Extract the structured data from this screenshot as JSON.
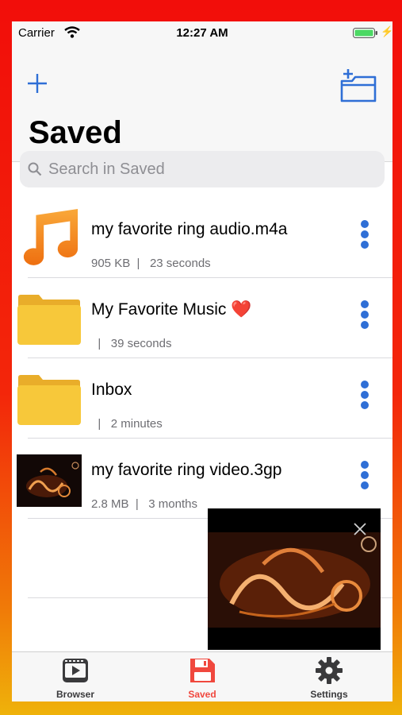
{
  "status_bar": {
    "carrier": "Carrier",
    "time": "12:27 AM"
  },
  "header": {
    "title": "Saved",
    "add_icon": "plus-icon",
    "new_folder_icon": "folder-plus-icon"
  },
  "search": {
    "placeholder": "Search in Saved",
    "value": ""
  },
  "items": [
    {
      "name": "my favorite ring audio.m4a",
      "meta": "905 KB  |   23 seconds",
      "icon": "music-note-icon"
    },
    {
      "name": "My Favorite Music ❤️",
      "meta": "  |   39 seconds",
      "icon": "folder-icon"
    },
    {
      "name": "Inbox",
      "meta": "  |   2 minutes",
      "icon": "folder-icon"
    },
    {
      "name": "my favorite ring video.3gp",
      "meta": "2.8 MB  |   3 months",
      "icon": "video-thumbnail"
    }
  ],
  "tabs": [
    {
      "label": "Browser",
      "icon": "browser-icon",
      "color": "#3a3a3c"
    },
    {
      "label": "Saved",
      "icon": "save-disk-icon",
      "color": "#f0483e"
    },
    {
      "label": "Settings",
      "icon": "gear-icon",
      "color": "#3a3a3c"
    }
  ],
  "colors": {
    "accent": "#2f6fd6",
    "active_tab": "#f0483e",
    "folder": "#f7c83a",
    "music": "#f28a1e"
  }
}
